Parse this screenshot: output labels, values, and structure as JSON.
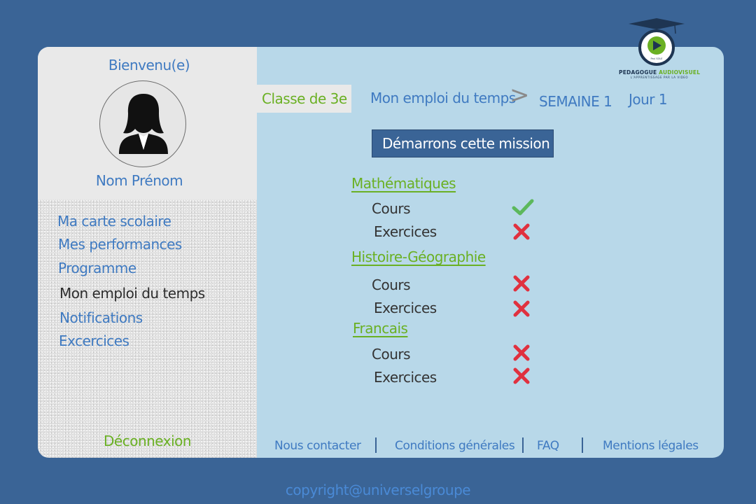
{
  "sidebar": {
    "welcome": "Bienvenu(e)",
    "user_name": "Nom Prénom",
    "nav": [
      {
        "label": "Ma carte scolaire",
        "active": false
      },
      {
        "label": "Mes performances",
        "active": false
      },
      {
        "label": "Programme",
        "active": false
      },
      {
        "label": "Mon emploi du temps",
        "active": true
      },
      {
        "label": "Notifications",
        "active": false
      },
      {
        "label": "Excercices",
        "active": false
      }
    ],
    "logout": "Déconnexion"
  },
  "header": {
    "class_label": "Classe de 3e",
    "breadcrumb": {
      "page": "Mon emploi du temps",
      "separator": ">",
      "week": "SEMAINE 1",
      "day": "Jour 1"
    }
  },
  "logo": {
    "brand_part1": "PEDAGOGUE ",
    "brand_part2": "AUDIOVISUEL",
    "tagline": "L'APPRENTISSAGE PAR LA VIDEO",
    "badge_text": "Par/ SOLE"
  },
  "main": {
    "mission_button": "Démarrons cette mission",
    "subjects": [
      {
        "name": "Mathématiques",
        "tasks": [
          {
            "label": "Cours",
            "status": "done"
          },
          {
            "label": "Exercices",
            "status": "todo"
          }
        ]
      },
      {
        "name": "Histoire-Géographie",
        "tasks": [
          {
            "label": "Cours",
            "status": "todo"
          },
          {
            "label": "Exercices",
            "status": "todo"
          }
        ]
      },
      {
        "name": "Francais",
        "tasks": [
          {
            "label": "Cours",
            "status": "todo"
          },
          {
            "label": "Exercices",
            "status": "todo"
          }
        ]
      }
    ]
  },
  "footer": {
    "links": [
      "Nous contacter",
      "Conditions générales",
      "FAQ",
      "Mentions légales"
    ]
  },
  "copyright": "copyright@universelgroupe",
  "colors": {
    "background": "#3a6496",
    "panel": "#b8d8e9",
    "accent_green": "#6ab023",
    "link_blue": "#3f7ac1",
    "check_green": "#5cb85c",
    "cross_red": "#e0313f"
  },
  "icons": {
    "done": "check-icon",
    "todo": "cross-icon"
  }
}
